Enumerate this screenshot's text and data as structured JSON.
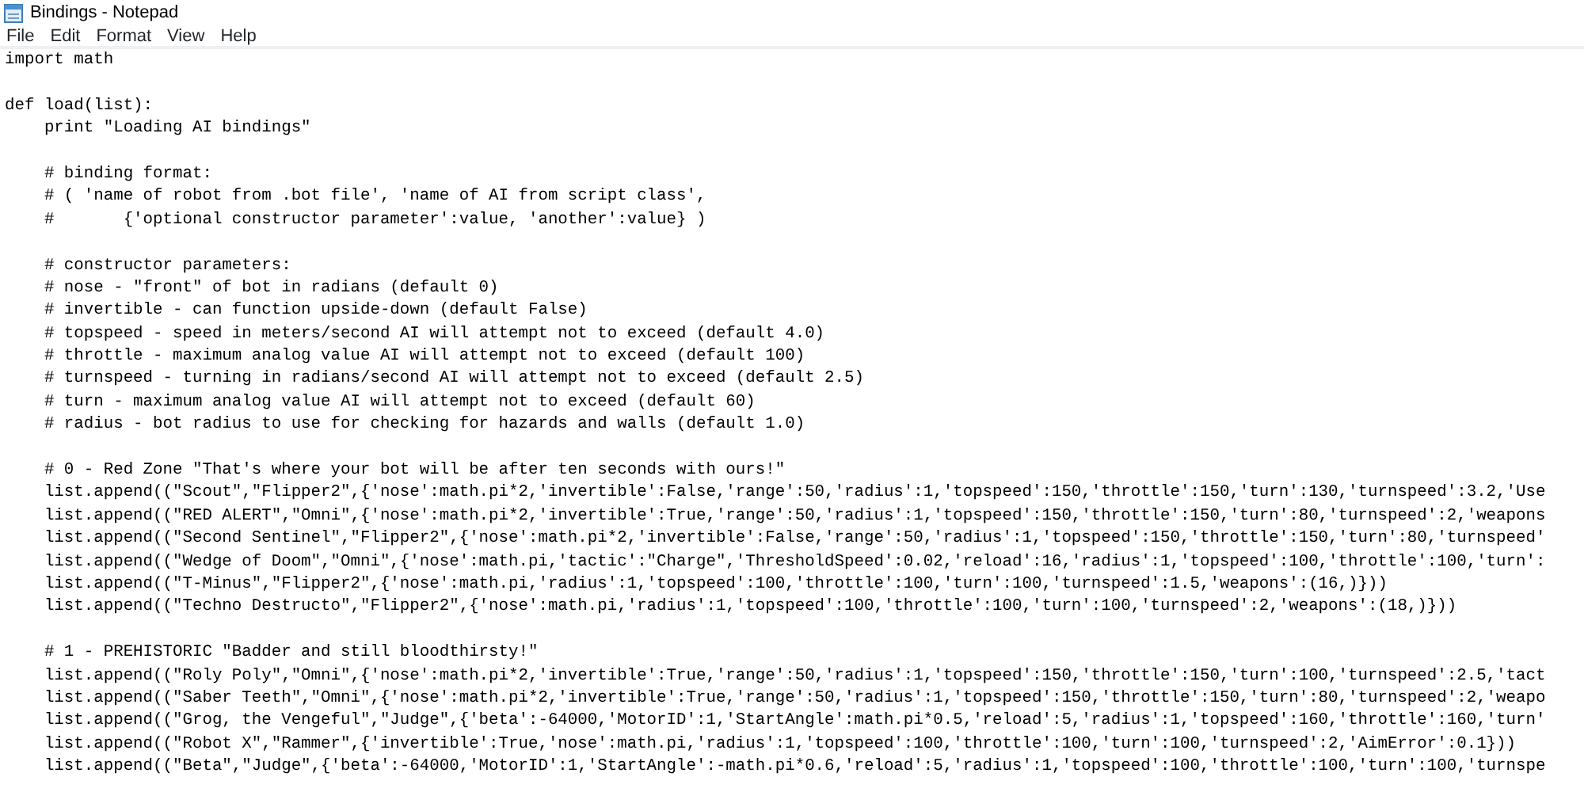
{
  "window": {
    "title": "Bindings - Notepad"
  },
  "menu": [
    "File",
    "Edit",
    "Format",
    "View",
    "Help"
  ],
  "blocks": [
    [
      "import math"
    ],
    [
      "def load(list):",
      "    print \"Loading AI bindings\""
    ],
    [
      "    # binding format:",
      "    # ( 'name of robot from .bot file', 'name of AI from script class',",
      "    #       {'optional constructor parameter':value, 'another':value} )"
    ],
    [
      "    # constructor parameters:",
      "    # nose - \"front\" of bot in radians (default 0)",
      "    # invertible - can function upside-down (default False)",
      "    # topspeed - speed in meters/second AI will attempt not to exceed (default 4.0)",
      "    # throttle - maximum analog value AI will attempt not to exceed (default 100)",
      "    # turnspeed - turning in radians/second AI will attempt not to exceed (default 2.5)",
      "    # turn - maximum analog value AI will attempt not to exceed (default 60)",
      "    # radius - bot radius to use for checking for hazards and walls (default 1.0)"
    ],
    [
      "    # 0 - Red Zone \"That's where your bot will be after ten seconds with ours!\"",
      "    list.append((\"Scout\",\"Flipper2\",{'nose':math.pi*2,'invertible':False,'range':50,'radius':1,'topspeed':150,'throttle':150,'turn':130,'turnspeed':3.2,'Use",
      "    list.append((\"RED ALERT\",\"Omni\",{'nose':math.pi*2,'invertible':True,'range':50,'radius':1,'topspeed':150,'throttle':150,'turn':80,'turnspeed':2,'weapons",
      "    list.append((\"Second Sentinel\",\"Flipper2\",{'nose':math.pi*2,'invertible':False,'range':50,'radius':1,'topspeed':150,'throttle':150,'turn':80,'turnspeed'",
      "    list.append((\"Wedge of Doom\",\"Omni\",{'nose':math.pi,'tactic':\"Charge\",'ThresholdSpeed':0.02,'reload':16,'radius':1,'topspeed':100,'throttle':100,'turn':",
      "    list.append((\"T-Minus\",\"Flipper2\",{'nose':math.pi,'radius':1,'topspeed':100,'throttle':100,'turn':100,'turnspeed':1.5,'weapons':(16,)}))",
      "    list.append((\"Techno Destructo\",\"Flipper2\",{'nose':math.pi,'radius':1,'topspeed':100,'throttle':100,'turn':100,'turnspeed':2,'weapons':(18,)}))"
    ],
    [
      "    # 1 - PREHISTORIC \"Badder and still bloodthirsty!\"",
      "    list.append((\"Roly Poly\",\"Omni\",{'nose':math.pi*2,'invertible':True,'range':50,'radius':1,'topspeed':150,'throttle':150,'turn':100,'turnspeed':2.5,'tact",
      "    list.append((\"Saber Teeth\",\"Omni\",{'nose':math.pi*2,'invertible':True,'range':50,'radius':1,'topspeed':150,'throttle':150,'turn':80,'turnspeed':2,'weapo",
      "    list.append((\"Grog, the Vengeful\",\"Judge\",{'beta':-64000,'MotorID':1,'StartAngle':math.pi*0.5,'reload':5,'radius':1,'topspeed':160,'throttle':160,'turn'",
      "    list.append((\"Robot X\",\"Rammer\",{'invertible':True,'nose':math.pi,'radius':1,'topspeed':100,'throttle':100,'turn':100,'turnspeed':2,'AimError':0.1}))",
      "    list.append((\"Beta\",\"Judge\",{'beta':-64000,'MotorID':1,'StartAngle':-math.pi*0.6,'reload':5,'radius':1,'topspeed':100,'throttle':100,'turn':100,'turnspe"
    ]
  ]
}
